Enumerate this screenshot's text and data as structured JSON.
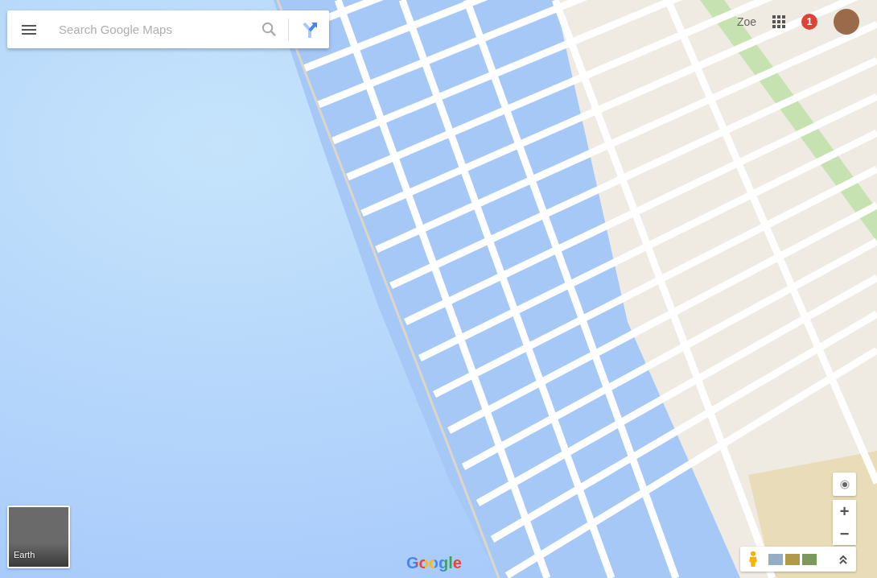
{
  "search": {
    "placeholder": "Search Google Maps"
  },
  "account": {
    "name": "Zoe",
    "notifications": "1"
  },
  "zoom_controls": {
    "zoom_in": "+",
    "zoom_out": "−"
  },
  "layer_switcher": {
    "label": "Earth"
  },
  "logo": "Google"
}
